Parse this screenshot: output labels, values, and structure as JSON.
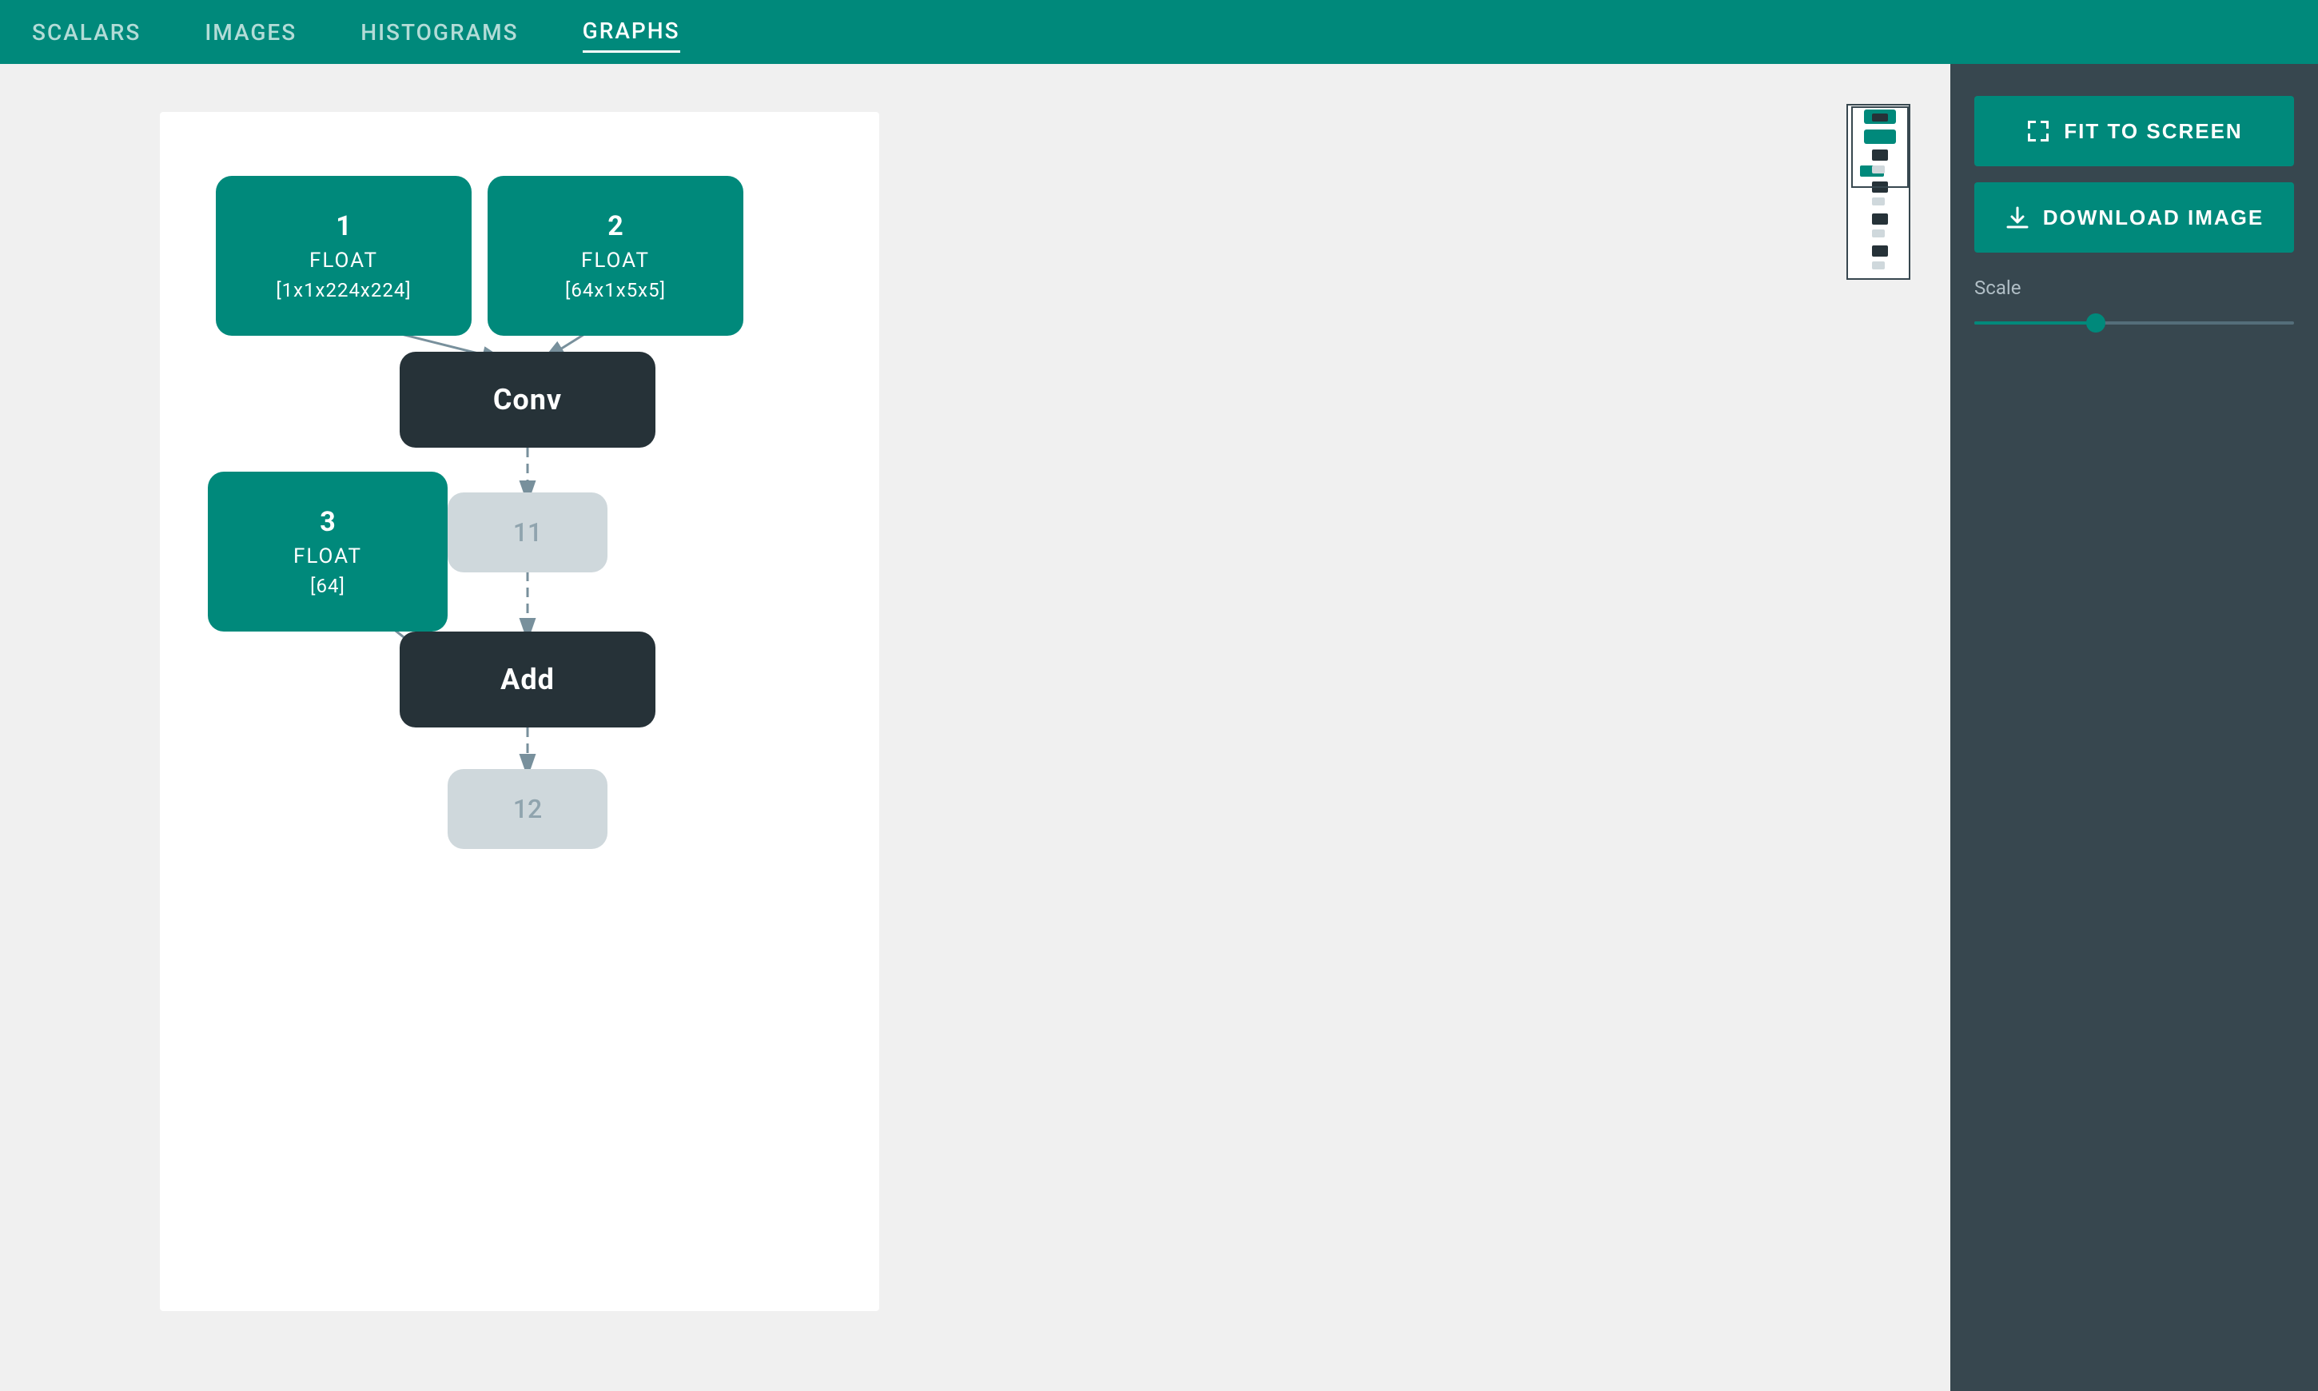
{
  "header": {
    "tabs": [
      {
        "label": "SCALARS",
        "active": false
      },
      {
        "label": "IMAGES",
        "active": false
      },
      {
        "label": "HISTOGRAMS",
        "active": false
      },
      {
        "label": "GRAPHS",
        "active": true
      }
    ]
  },
  "sidebar": {
    "fit_to_screen_label": "FIT TO SCREEN",
    "download_image_label": "DOWNLOAD IMAGE",
    "scale_label": "Scale",
    "scale_value": 40
  },
  "graph": {
    "nodes": [
      {
        "id": "node1",
        "type": "teal",
        "number": "1",
        "data_type": "FLOAT",
        "shape": "[1x1x224x224]"
      },
      {
        "id": "node2",
        "type": "teal",
        "number": "2",
        "data_type": "FLOAT",
        "shape": "[64x1x5x5]"
      },
      {
        "id": "conv",
        "type": "dark",
        "label": "Conv"
      },
      {
        "id": "node3",
        "type": "teal",
        "number": "3",
        "data_type": "FLOAT",
        "shape": "[64]"
      },
      {
        "id": "node11",
        "type": "light",
        "label": "11"
      },
      {
        "id": "add",
        "type": "dark",
        "label": "Add"
      },
      {
        "id": "node12",
        "type": "light",
        "label": "12"
      }
    ]
  }
}
